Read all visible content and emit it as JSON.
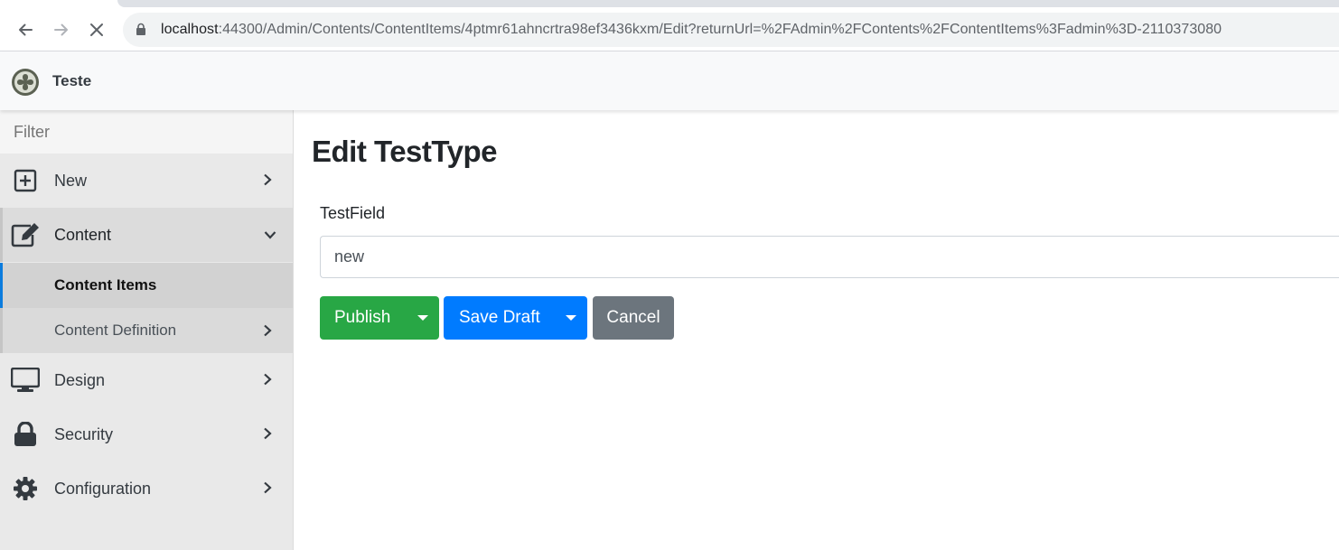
{
  "browser": {
    "url_host": "localhost",
    "url_rest": ":44300/Admin/Contents/ContentItems/4ptmr61ahncrtra98ef3436kxm/Edit?returnUrl=%2FAdmin%2FContents%2FContentItems%3Fadmin%3D-2110373080"
  },
  "header": {
    "brand": "Teste"
  },
  "sidebar": {
    "filter_placeholder": "Filter",
    "items": [
      {
        "label": "New",
        "icon": "plus-square-icon"
      },
      {
        "label": "Content",
        "icon": "edit-icon"
      },
      {
        "label": "Design",
        "icon": "desktop-icon"
      },
      {
        "label": "Security",
        "icon": "lock-icon"
      },
      {
        "label": "Configuration",
        "icon": "gear-icon"
      }
    ],
    "sub_items": [
      {
        "label": "Content Items"
      },
      {
        "label": "Content Definition"
      }
    ]
  },
  "main": {
    "title": "Edit TestType",
    "field_label": "TestField",
    "field_value": "new",
    "publish_label": "Publish",
    "save_draft_label": "Save Draft",
    "cancel_label": "Cancel"
  },
  "colors": {
    "publish": "#28a745",
    "save_draft": "#007bff",
    "cancel": "#6c757d",
    "active_indicator": "#0b7cde"
  }
}
